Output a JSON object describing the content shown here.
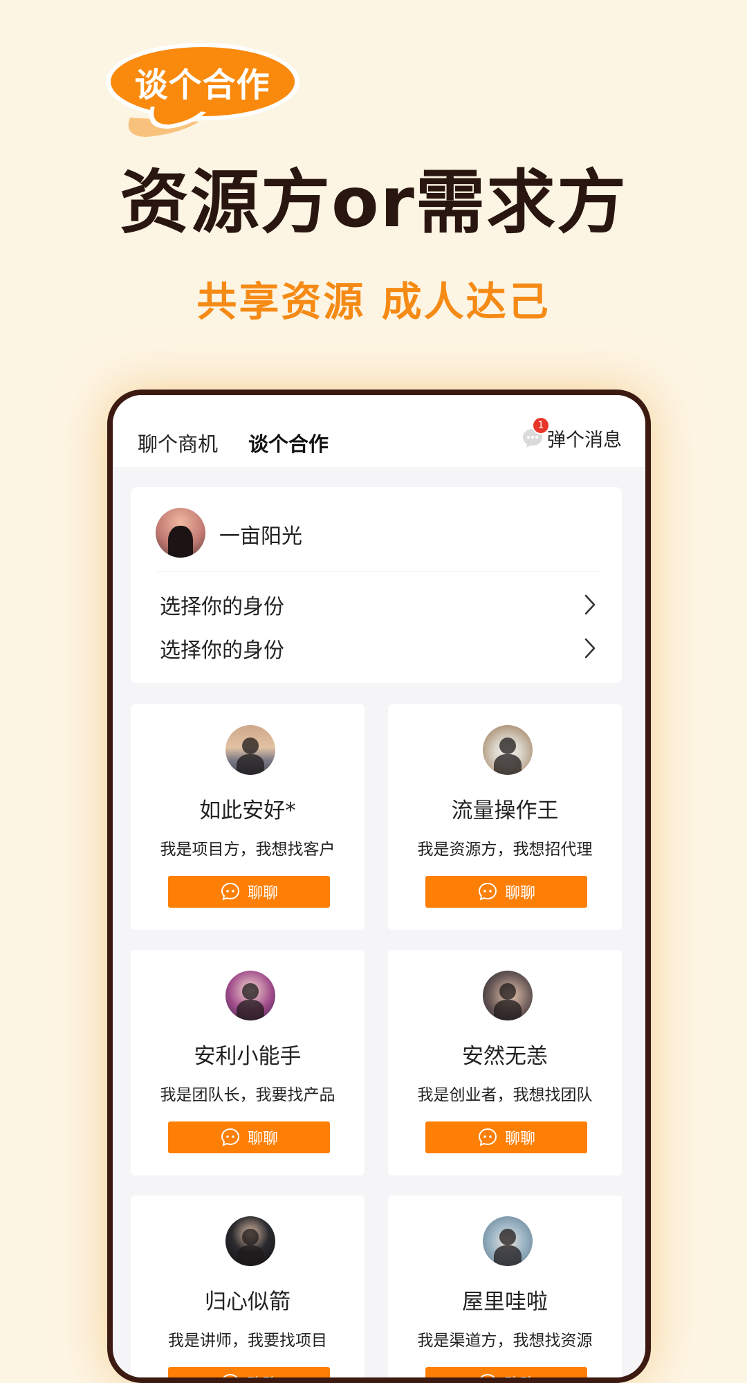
{
  "hero": {
    "badge": "谈个合作",
    "headline": "资源方or需求方",
    "subline": "共享资源 成人达己",
    "colors": {
      "accent": "#f58a15",
      "dark": "#2a1610",
      "background": "#fdf5e4"
    }
  },
  "phone": {
    "tabs": [
      {
        "label": "聊个商机",
        "active": false
      },
      {
        "label": "谈个合作",
        "active": true
      }
    ],
    "messages": {
      "label": "弹个消息",
      "badge_count": "1",
      "icon": "chat-bubble-icon"
    },
    "profile": {
      "name": "一亩阳光",
      "rows": [
        {
          "label": "选择你的身份",
          "icon": "chevron-right-icon"
        },
        {
          "label": "选择你的身份",
          "icon": "chevron-right-icon"
        }
      ]
    },
    "users": [
      {
        "name": "如此安好*",
        "desc": "我是项目方，我想找客户",
        "button": "聊聊"
      },
      {
        "name": "流量操作王",
        "desc": "我是资源方，我想招代理",
        "button": "聊聊"
      },
      {
        "name": "安利小能手",
        "desc": "我是团队长，我要找产品",
        "button": "聊聊"
      },
      {
        "name": "安然无恙",
        "desc": "我是创业者，我想找团队",
        "button": "聊聊"
      },
      {
        "name": "归心似箭",
        "desc": "我是讲师，我要找项目",
        "button": "聊聊"
      },
      {
        "name": "屋里哇啦",
        "desc": "我是渠道方，我想找资源",
        "button": "聊聊"
      }
    ],
    "button_color": "#fd7f05"
  }
}
